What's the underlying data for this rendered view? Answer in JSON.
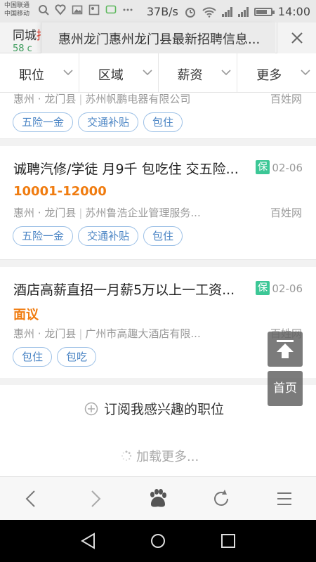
{
  "status_bar": {
    "carrier1": "中国联通",
    "carrier2": "中国移动",
    "speed": "37B/s",
    "time": "14:00"
  },
  "title_bar": {
    "background_title_prefix": "同城",
    "background_title_highlight": "招聘",
    "background_subtitle": "58 c",
    "tab_title": "惠州龙门惠州龙门县最新招聘信息..."
  },
  "filters": [
    {
      "label": "职位"
    },
    {
      "label": "区域"
    },
    {
      "label": "薪资"
    },
    {
      "label": "更多"
    }
  ],
  "jobs": [
    {
      "location_city": "惠州",
      "location_county": "龙门县",
      "company": "苏州帆鹏电器有限公司",
      "source": "百姓网",
      "tags": [
        "五险一金",
        "交通补贴",
        "包住"
      ]
    },
    {
      "title": "诚聘汽修/学徒 月9千 包吃住 交五险...",
      "badge": "保",
      "date": "02-06",
      "salary": "10001-12000",
      "location_city": "惠州",
      "location_county": "龙门县",
      "company": "苏州鲁浩企业管理服务...",
      "source": "百姓网",
      "tags": [
        "五险一金",
        "交通补贴",
        "包住"
      ]
    },
    {
      "title": "酒店高薪直招一月薪5万以上一工资...",
      "badge": "保",
      "date": "02-06",
      "salary": "面议",
      "location_city": "惠州",
      "location_county": "龙门县",
      "company": "广州市高趣大酒店有限...",
      "source": "百姓网",
      "tags": [
        "包住",
        "包吃"
      ]
    }
  ],
  "subscribe_label": "订阅我感兴趣的职位",
  "load_more_label": "加载更多...",
  "home_button_label": "首页",
  "colors": {
    "salary": "#f07c10",
    "tag_border": "#9cc0e6",
    "tag_text": "#4a84c4",
    "badge": "#3cc796"
  }
}
